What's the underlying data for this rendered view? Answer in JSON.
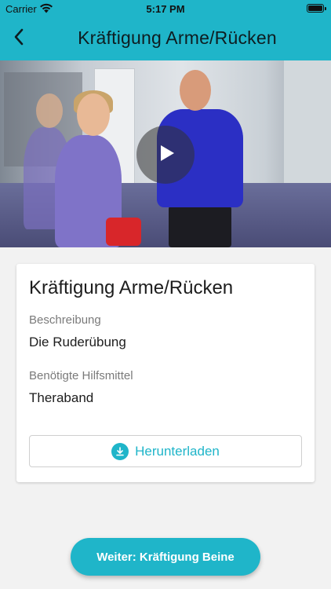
{
  "status_bar": {
    "carrier": "Carrier",
    "time": "5:17 PM",
    "wifi_icon": "wifi-icon",
    "battery_icon": "battery-icon"
  },
  "nav": {
    "title": "Kräftigung Arme/Rücken",
    "back_icon": "chevron-left-icon"
  },
  "video": {
    "play_icon": "play-icon"
  },
  "card": {
    "title": "Kräftigung Arme/Rücken",
    "description_label": "Beschreibung",
    "description_value": "Die Ruderübung",
    "tools_label": "Benötigte Hilfsmittel",
    "tools_value": "Theraband",
    "download_label": "Herunterladen",
    "download_icon": "download-icon"
  },
  "next_button": {
    "label": "Weiter: Kräftigung Beine"
  },
  "colors": {
    "accent": "#1fb5c9",
    "background": "#f2f2f2",
    "card": "#ffffff"
  }
}
